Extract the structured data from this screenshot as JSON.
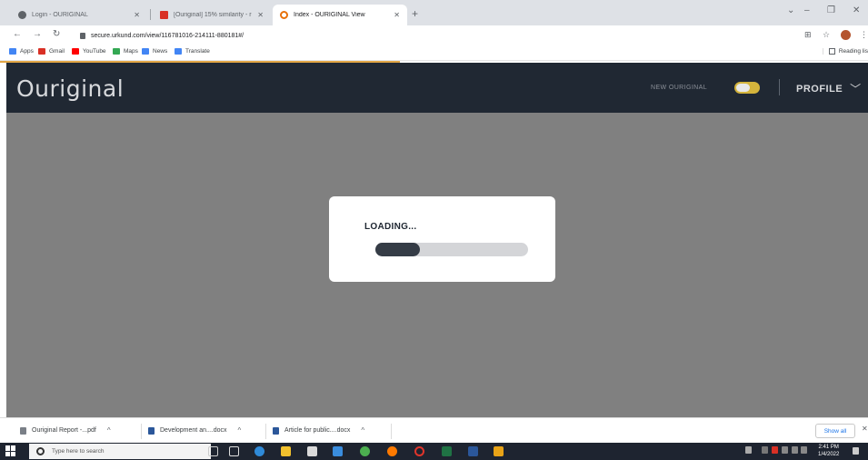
{
  "browser": {
    "tabs": [
      {
        "title": "Login - OURIGINAL",
        "color": "#5f6368",
        "active": false
      },
      {
        "title": "[Ouriginal] 15% similarity - resea",
        "color": "#d93025",
        "active": false
      },
      {
        "title": "Index - OURIGINAL View",
        "color": "#e8710a",
        "active": true
      }
    ],
    "new_tab_symbol": "+",
    "url": "secure.urkund.com/view/116781016-214111-880181#/",
    "bookmarks": [
      {
        "label": "Apps",
        "color": "#4285f4"
      },
      {
        "label": "Gmail",
        "color": "#d93025"
      },
      {
        "label": "YouTube",
        "color": "#ff0000"
      },
      {
        "label": "Maps",
        "color": "#34a853"
      },
      {
        "label": "News",
        "color": "#4285f4"
      },
      {
        "label": "Translate",
        "color": "#4285f4"
      }
    ],
    "reading_list": "Reading lis"
  },
  "app": {
    "logo": "Ouriginal",
    "new_ouriginal_label": "NEW OURIGINAL",
    "new_ouriginal_on": true,
    "profile_label": "PROFILE",
    "colors": {
      "header": "#202833",
      "toggle": "#d4b43c",
      "overlay": "#808080"
    }
  },
  "loading": {
    "label": "LOADING...",
    "progress": 0.29
  },
  "downloads": {
    "items": [
      {
        "name": "Ouriginal Report -...pdf"
      },
      {
        "name": "Development an....docx"
      },
      {
        "name": "Article for public....docx"
      }
    ],
    "show_all": "Show all"
  },
  "taskbar": {
    "search_placeholder": "Type here to search",
    "time": "2:41 PM",
    "date": "1/4/2022"
  }
}
